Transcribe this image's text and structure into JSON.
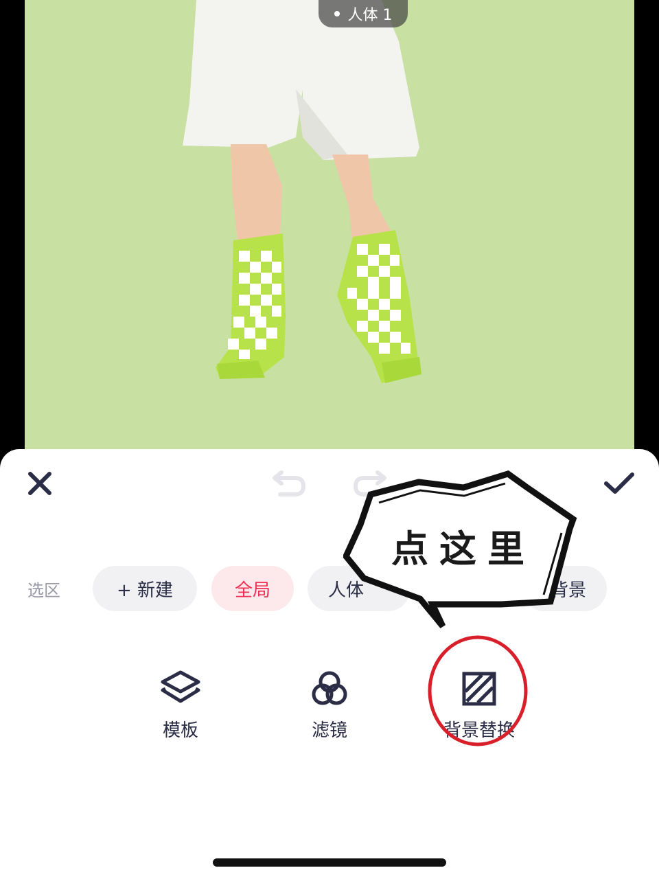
{
  "photo": {
    "person_chip": "人体 1"
  },
  "toolbar": {
    "close_icon": "close-icon",
    "undo_icon": "undo-icon",
    "redo_icon": "redo-icon",
    "confirm_icon": "check-icon"
  },
  "selection": {
    "label": "选区",
    "chips": [
      {
        "label": "+ 新建",
        "active": false
      },
      {
        "label": "全局",
        "active": true
      },
      {
        "label": "人体",
        "active": false
      },
      {
        "label": "背景",
        "active": false
      }
    ]
  },
  "tools": [
    {
      "label": "模板",
      "icon": "layers-icon"
    },
    {
      "label": "滤镜",
      "icon": "filter-circles-icon"
    },
    {
      "label": "背景替换",
      "icon": "background-replace-icon"
    }
  ],
  "annotation": {
    "bubble_text": "点这里"
  },
  "colors": {
    "accent": "#ee2f53",
    "dark": "#2a2d45",
    "annotation_circle": "#d81f2a"
  }
}
